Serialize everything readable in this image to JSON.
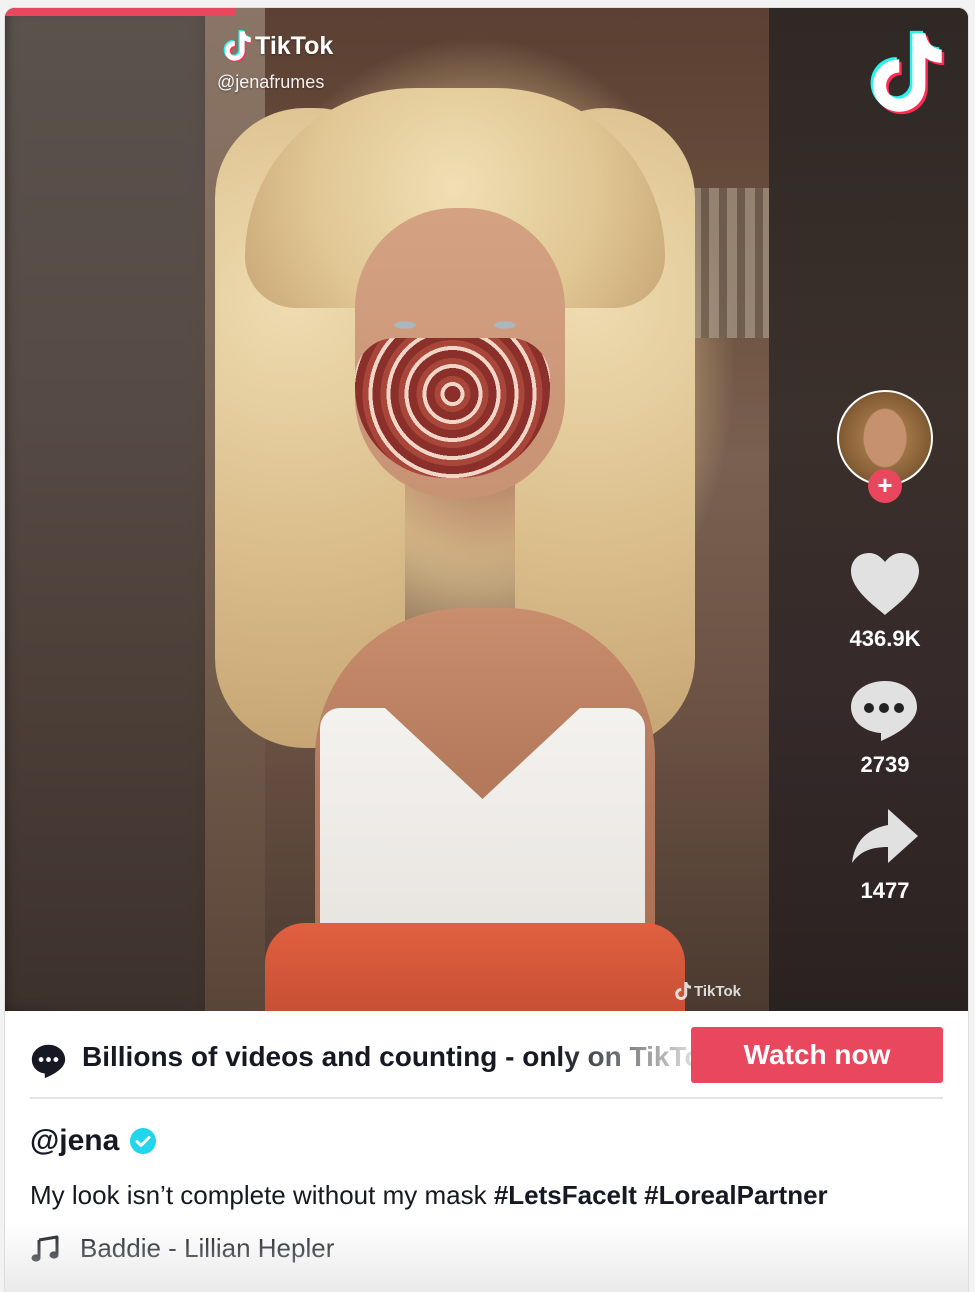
{
  "player": {
    "progress_fraction": 0.24,
    "watermark_top": {
      "brand": "TikTok",
      "handle": "@jenafrumes"
    },
    "watermark_bottom": {
      "brand": "TikTok"
    },
    "logo_icon": "tiktok-logo-icon"
  },
  "actions": {
    "follow_symbol": "+",
    "likes": {
      "icon": "heart-icon",
      "count": "436.9K"
    },
    "comments": {
      "icon": "comment-bubble-icon",
      "count": "2739"
    },
    "shares": {
      "icon": "share-arrow-icon",
      "count": "1477"
    }
  },
  "promo": {
    "icon": "chat-bubble-icon",
    "text": "Billions of videos and counting - only on TikTok",
    "button_label": "Watch now"
  },
  "post": {
    "author": "@jena",
    "verified_icon": "verified-check-icon",
    "caption_text": "My look isn’t complete without my mask",
    "hashtags": [
      "#LetsFaceIt",
      "#LorealPartner"
    ],
    "music_icon": "music-note-icon",
    "music": "Baddie - Lillian Hepler"
  },
  "colors": {
    "accent": "#e8475d",
    "text": "#161823",
    "verified": "#20d5ec",
    "tiktok_cyan": "#25f4ee",
    "tiktok_red": "#fe2c55"
  }
}
